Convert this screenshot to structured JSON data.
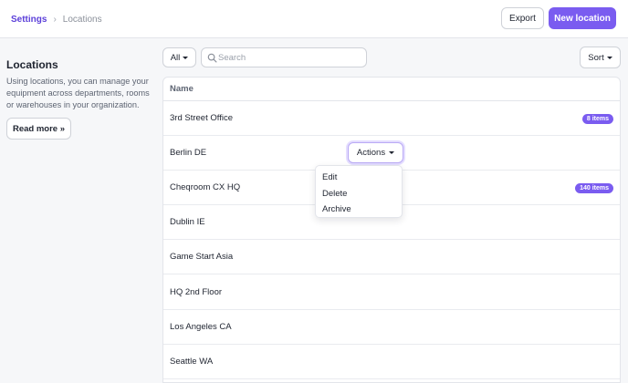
{
  "breadcrumb": {
    "root": "Settings",
    "current": "Locations"
  },
  "header": {
    "export_label": "Export",
    "new_label": "New location"
  },
  "sidebar": {
    "title": "Locations",
    "description": "Using locations, you can manage your equipment across departments, rooms or warehouses in your organization.",
    "read_more": "Read more »"
  },
  "toolbar": {
    "filter_label": "All",
    "search_placeholder": "Search",
    "search_value": "",
    "sort_label": "Sort"
  },
  "table": {
    "header": "Name",
    "rows": [
      {
        "name": "3rd Street Office",
        "badge": "8 items"
      },
      {
        "name": "Berlin DE",
        "badge": ""
      },
      {
        "name": "Cheqroom CX HQ",
        "badge": "140 items"
      },
      {
        "name": "Dublin IE",
        "badge": ""
      },
      {
        "name": "Game Start Asia",
        "badge": ""
      },
      {
        "name": "HQ 2nd Floor",
        "badge": ""
      },
      {
        "name": "Los Angeles CA",
        "badge": ""
      },
      {
        "name": "Seattle WA",
        "badge": ""
      }
    ]
  },
  "actions": {
    "label": "Actions",
    "menu": [
      "Edit",
      "Delete",
      "Archive"
    ]
  },
  "colors": {
    "accent": "#7a5cf0",
    "link": "#5b3fd9"
  },
  "icons": {
    "search": "search-icon",
    "breadcrumb_sep": "chevron-right-icon",
    "caret": "caret-down-icon"
  }
}
